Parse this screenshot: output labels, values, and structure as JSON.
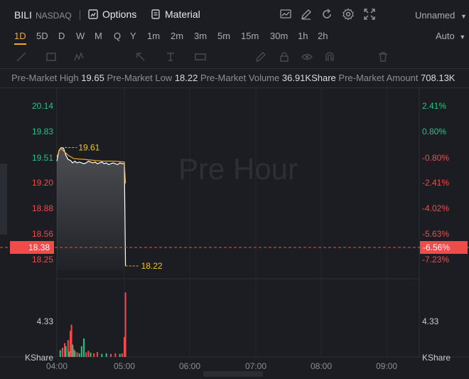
{
  "header": {
    "symbol": "BILI",
    "exchange": "NASDAQ",
    "options_label": "Options",
    "material_label": "Material",
    "layout_name": "Unnamed",
    "icons": [
      "chart-icon",
      "edit-icon",
      "refresh-icon",
      "gear-icon",
      "fullscreen-icon"
    ]
  },
  "timeframes": [
    "1D",
    "5D",
    "D",
    "W",
    "M",
    "Q",
    "Y",
    "1m",
    "2m",
    "3m",
    "5m",
    "15m",
    "30m",
    "1h",
    "2h"
  ],
  "active_timeframe": "1D",
  "scale_mode": "Auto",
  "premarket": {
    "high_label": "Pre-Market High",
    "high": "19.65",
    "low_label": "Pre-Market Low",
    "low": "18.22",
    "volume_label": "Pre-Market Volume",
    "volume": "36.91KShare",
    "amount_label": "Pre-Market Amount",
    "amount": "708.13K"
  },
  "colors": {
    "up": "#26c281",
    "down": "#f04b4b",
    "accent": "#f0a830",
    "line": "#ffffff",
    "avg": "#f0a830",
    "grid": "#2b2e35"
  },
  "chart_data": {
    "type": "line",
    "watermark": "Pre Hour",
    "price_ticks": [
      "20.14",
      "19.83",
      "19.51",
      "19.20",
      "18.88",
      "18.56",
      "18.25"
    ],
    "pct_ticks": [
      "2.41%",
      "0.80%",
      "-0.80%",
      "-2.41%",
      "-4.02%",
      "-5.63%",
      "-7.23%"
    ],
    "current_price": "18.38",
    "current_pct": "-6.56%",
    "high_marker": "19.61",
    "low_marker": "18.22",
    "ylim": [
      18.17,
      20.24
    ],
    "x_ticks": [
      "04:00",
      "05:00",
      "06:00",
      "07:00",
      "08:00",
      "09:00"
    ],
    "volume_axis_value": "4.33",
    "volume_unit": "KShare",
    "price_series": [
      [
        0,
        19.45
      ],
      [
        2,
        19.58
      ],
      [
        4,
        19.61
      ],
      [
        6,
        19.6
      ],
      [
        8,
        19.52
      ],
      [
        10,
        19.47
      ],
      [
        12,
        19.46
      ],
      [
        14,
        19.43
      ],
      [
        16,
        19.45
      ],
      [
        18,
        19.43
      ],
      [
        20,
        19.44
      ],
      [
        22,
        19.43
      ],
      [
        24,
        19.42
      ],
      [
        26,
        19.43
      ],
      [
        28,
        19.45
      ],
      [
        30,
        19.44
      ],
      [
        32,
        19.43
      ],
      [
        34,
        19.44
      ],
      [
        36,
        19.42
      ],
      [
        38,
        19.43
      ],
      [
        40,
        19.44
      ],
      [
        42,
        19.42
      ],
      [
        44,
        19.43
      ],
      [
        46,
        19.41
      ],
      [
        48,
        19.42
      ],
      [
        50,
        19.43
      ],
      [
        52,
        19.42
      ],
      [
        54,
        19.41
      ],
      [
        56,
        19.43
      ],
      [
        58,
        19.42
      ],
      [
        60,
        19.42
      ],
      [
        61,
        18.22
      ]
    ],
    "avg_series": [
      [
        0,
        19.5
      ],
      [
        3,
        19.6
      ],
      [
        6,
        19.57
      ],
      [
        10,
        19.52
      ],
      [
        15,
        19.48
      ],
      [
        25,
        19.47
      ],
      [
        40,
        19.45
      ],
      [
        50,
        19.45
      ],
      [
        60,
        19.44
      ],
      [
        61,
        19.19
      ]
    ],
    "volume_bars": [
      [
        3,
        0.22,
        "up"
      ],
      [
        5,
        0.3,
        "down"
      ],
      [
        7,
        0.45,
        "down"
      ],
      [
        8,
        0.35,
        "up"
      ],
      [
        10,
        0.55,
        "down"
      ],
      [
        11,
        0.18,
        "up"
      ],
      [
        12,
        0.85,
        "down"
      ],
      [
        13,
        1.05,
        "down"
      ],
      [
        14,
        0.4,
        "up"
      ],
      [
        15,
        0.25,
        "down"
      ],
      [
        16,
        0.2,
        "up"
      ],
      [
        18,
        0.15,
        "down"
      ],
      [
        20,
        0.12,
        "up"
      ],
      [
        22,
        0.35,
        "up"
      ],
      [
        24,
        0.6,
        "up"
      ],
      [
        26,
        0.15,
        "down"
      ],
      [
        28,
        0.2,
        "down"
      ],
      [
        30,
        0.14,
        "up"
      ],
      [
        33,
        0.12,
        "down"
      ],
      [
        36,
        0.16,
        "down"
      ],
      [
        40,
        0.1,
        "up"
      ],
      [
        44,
        0.12,
        "up"
      ],
      [
        48,
        0.1,
        "down"
      ],
      [
        52,
        0.12,
        "down"
      ],
      [
        56,
        0.1,
        "up"
      ],
      [
        58,
        0.12,
        "down"
      ],
      [
        60,
        0.65,
        "down"
      ],
      [
        61,
        2.1,
        "down"
      ]
    ],
    "volume_max": 2.2
  }
}
